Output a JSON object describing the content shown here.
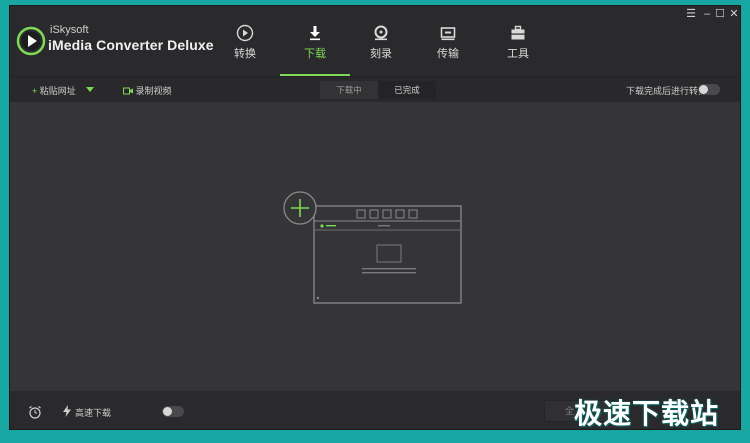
{
  "app": {
    "brand_small": "iSkysoft",
    "brand_name": "iMedia Converter Deluxe"
  },
  "tabs": [
    {
      "label": "转换",
      "icon": "convert-icon",
      "active": false
    },
    {
      "label": "下载",
      "icon": "download-icon",
      "active": true
    },
    {
      "label": "刻录",
      "icon": "burn-icon",
      "active": false
    },
    {
      "label": "传输",
      "icon": "transfer-icon",
      "active": false
    },
    {
      "label": "工具",
      "icon": "toolbox-icon",
      "active": false
    }
  ],
  "window_controls": [
    "menu-icon",
    "minimize-icon",
    "maximize-icon",
    "close-icon"
  ],
  "toolbar": {
    "paste_url": "粘贴网址",
    "record_video": "录制视频",
    "segments": [
      {
        "label": "下载中",
        "active": true
      },
      {
        "label": "已完成",
        "active": false
      }
    ],
    "convert_after_download": "下载完成后进行转换",
    "convert_after_download_on": false
  },
  "footer": {
    "high_speed": "高速下载",
    "high_speed_on": false,
    "download_all": "全"
  },
  "watermark": "极速下载站",
  "colors": {
    "accent": "#7ed957",
    "background": "#353537",
    "frame": "#17a6a1"
  }
}
